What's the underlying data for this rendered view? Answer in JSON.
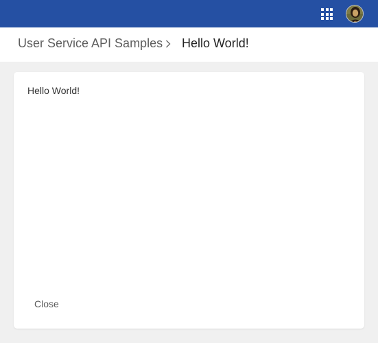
{
  "header": {
    "apps_icon": "apps-grid-icon",
    "avatar_icon": "user-avatar",
    "background_color": "#2550a3"
  },
  "breadcrumb": {
    "parent_label": "User Service API Samples",
    "separator_icon": "chevron-right-icon",
    "current_label": "Hello World!"
  },
  "panel": {
    "message": "Hello World!",
    "close_label": "Close"
  }
}
